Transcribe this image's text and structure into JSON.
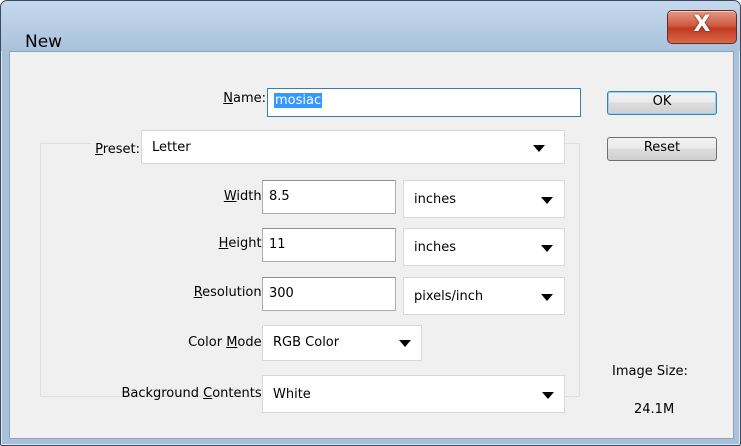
{
  "window": {
    "title": "New",
    "close_glyph": "X",
    "colors": {
      "titlebar": "#a9c2dc",
      "client": "#f0f0f0",
      "close_button": "#c9472d",
      "selection": "#3399ff"
    }
  },
  "name": {
    "label_pre": "",
    "label_ul": "N",
    "label_post": "ame:",
    "value": "mosiac"
  },
  "preset": {
    "label_pre": "",
    "label_ul": "P",
    "label_post": "reset:",
    "value": "Letter"
  },
  "width": {
    "label_pre": "",
    "label_ul": "W",
    "label_post": "idth:",
    "value": "8.5",
    "unit": "inches"
  },
  "height": {
    "label_pre": "",
    "label_ul": "H",
    "label_post": "eight:",
    "value": "11",
    "unit": "inches"
  },
  "resolution": {
    "label_pre": "",
    "label_ul": "R",
    "label_post": "esolution:",
    "value": "300",
    "unit": "pixels/inch"
  },
  "color_mode": {
    "label_pre": "Color ",
    "label_ul": "M",
    "label_post": "ode:",
    "value": "RGB Color"
  },
  "background": {
    "label_pre": "Background ",
    "label_ul": "C",
    "label_post": "ontents:",
    "value": "White"
  },
  "buttons": {
    "ok": "OK",
    "reset": "Reset"
  },
  "image_size": {
    "label": "Image Size:",
    "value": "24.1M"
  },
  "icons": {
    "dropdown_arrow": "chevron-down-icon",
    "close": "close-icon"
  }
}
